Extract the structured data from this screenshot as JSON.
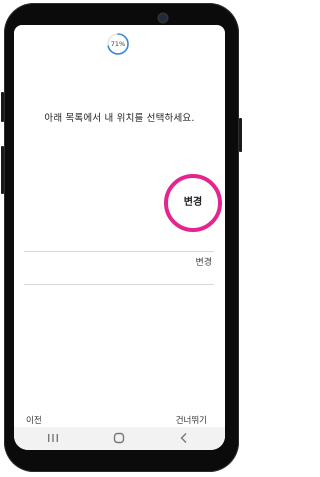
{
  "status": {
    "progress_percent": 71,
    "progress_label": "71%"
  },
  "instruction": "아래 목록에서 내 위치를 선택하세요.",
  "locations": [
    {
      "label": "변경"
    }
  ],
  "highlight": {
    "label": "변경",
    "ring_color": "#e4258f"
  },
  "footer": {
    "prev_label": "이전",
    "skip_label": "건너뛰기"
  },
  "nav_bar": {
    "icons": [
      "recent-apps-icon",
      "home-icon",
      "back-icon"
    ]
  },
  "colors": {
    "progress_accent": "#3b89d6",
    "highlight": "#e4258f"
  }
}
